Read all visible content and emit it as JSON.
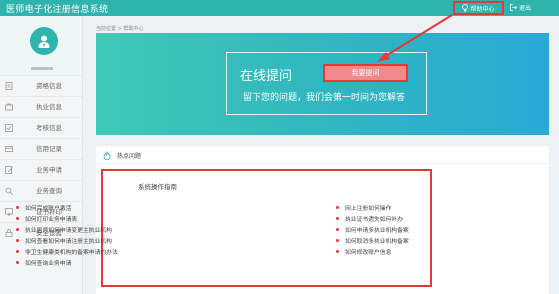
{
  "header": {
    "app_title": "医师电子化注册信息系统",
    "help_label": "帮助中心",
    "logout_label": "退出"
  },
  "sidebar": {
    "items": [
      {
        "label": "资格信息",
        "icon": "document-icon"
      },
      {
        "label": "执业信息",
        "icon": "briefcase-icon"
      },
      {
        "label": "考核信息",
        "icon": "checklist-icon"
      },
      {
        "label": "信用记录",
        "icon": "credit-card-icon"
      },
      {
        "label": "业务申请",
        "icon": "edit-form-icon"
      },
      {
        "label": "业务查询",
        "icon": "search-doc-icon"
      },
      {
        "label": "证书补印",
        "icon": "certificate-icon"
      },
      {
        "label": "安全设置",
        "icon": "lock-icon"
      }
    ]
  },
  "breadcrumb": "当前位置 > 帮助中心",
  "banner": {
    "title": "在线提问",
    "ask_button": "我要提问",
    "subtitle": "留下您的问题，我们会第一时间为您解答"
  },
  "hot": {
    "title": "热点问题",
    "guide_title": "系统操作指南",
    "left_links": [
      "如何完成账户激活",
      "如何打印业务申请表",
      "执业医师如何申请变更主执业机构",
      "如何查看如何申请注册主执业机构",
      "非卫生健康类机构的备案申请的办法",
      "如何查询业务申请"
    ],
    "right_links": [
      "网上注册如何操作",
      "执业证书遗失如何补办",
      "如何申请多执业机构备案",
      "如何取消多执业机构备案",
      "如何修改账户信息"
    ]
  },
  "colors": {
    "primary": "#2fb3ad",
    "highlight_border": "#e53935",
    "ask_button_bg": "#f0898a",
    "banner_start": "#3fc8b6",
    "banner_end": "#2aa8d6"
  }
}
